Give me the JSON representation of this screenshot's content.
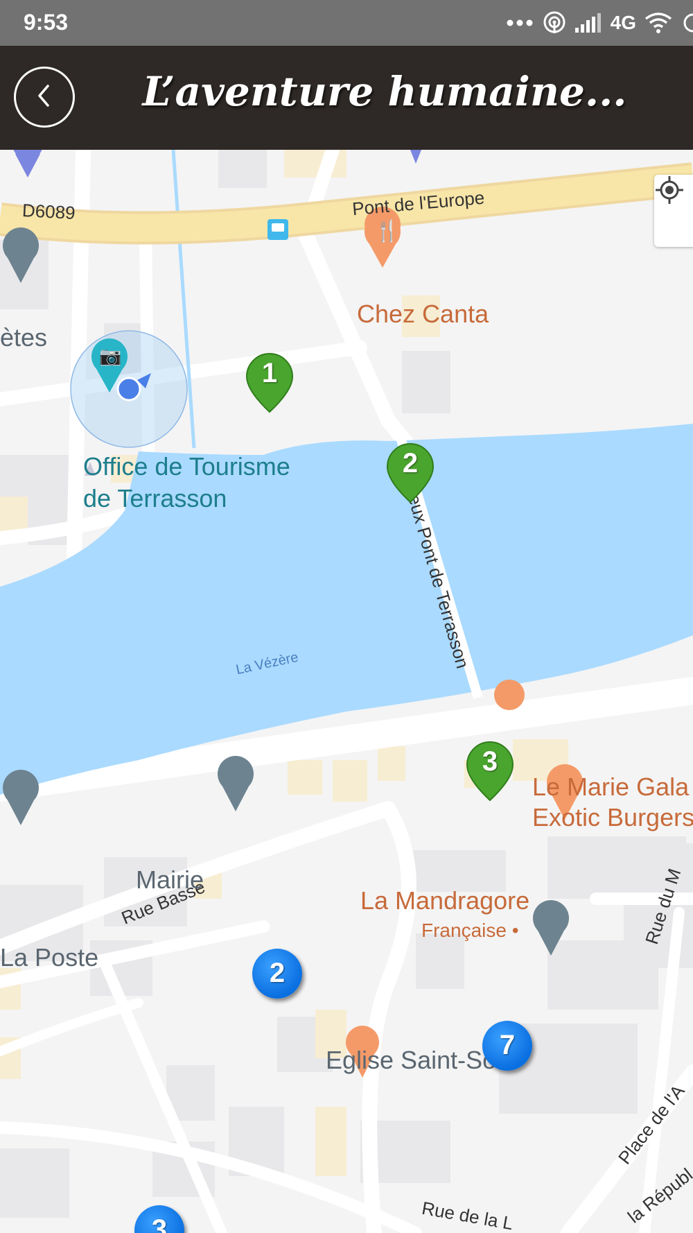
{
  "status_bar": {
    "time": "9:53",
    "network": "4G",
    "icons": [
      "more-dots-icon",
      "hotspot-icon",
      "signal-icon",
      "wifi-icon",
      "battery-icon"
    ]
  },
  "header": {
    "title": "L’aventure humaine...",
    "back_icon": "chevron-left-icon"
  },
  "map": {
    "road_labels": {
      "d6089": "D6089",
      "pont_europe": "Pont de l'Europe",
      "vieux_pont": "Vieux Pont de Terrasson",
      "rue_basse": "Rue Basse",
      "rue_du": "Rue du M",
      "place_de": "Place de l'A",
      "la_republique": "la Républ",
      "rue_de_la": "Rue de la L"
    },
    "water_label": "La Vézère",
    "places": {
      "chez_canta": "Chez Canta",
      "fetes": "ètes",
      "office_line1": "Office de Tourisme",
      "office_line2": "de Terrasson",
      "marie_line1": "Le Marie Gala",
      "marie_line2": "Exotic Burgers",
      "mairie": "Mairie",
      "mandragore": "La Mandragore",
      "francaise": "Française •",
      "la_poste": "La Poste",
      "eglise": "Eglise Saint-Sour"
    },
    "green_markers": [
      "1",
      "2",
      "3"
    ],
    "blue_markers": [
      "2",
      "7",
      "3"
    ],
    "locate_icon": "crosshair-icon",
    "colors": {
      "water": "#aadaff",
      "major_road": "#f8e5a6",
      "green_marker": "#4aa52e",
      "blue_marker": "#1a83f0",
      "header": "#2e2926"
    }
  }
}
